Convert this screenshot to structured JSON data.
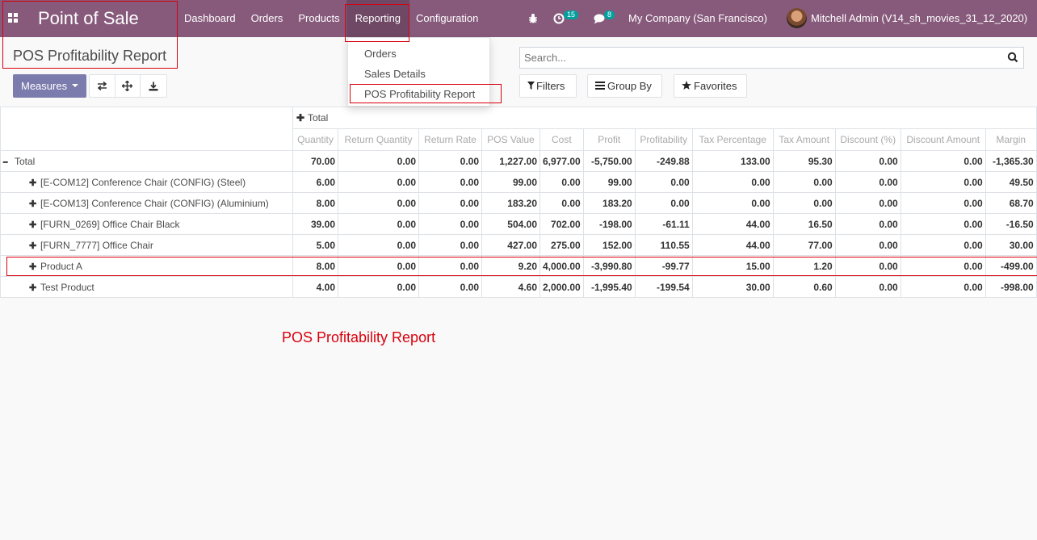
{
  "navbar": {
    "brand": "Point of Sale",
    "menu": [
      "Dashboard",
      "Orders",
      "Products",
      "Reporting",
      "Configuration"
    ],
    "activity_count": "15",
    "messages_count": "8",
    "company": "My Company (San Francisco)",
    "user": "Mitchell Admin (V14_sh_movies_31_12_2020)"
  },
  "reporting_menu": {
    "items": [
      "Orders",
      "Sales Details",
      "POS Profitability Report"
    ]
  },
  "control_panel": {
    "title": "POS Profitability Report",
    "measures_label": "Measures",
    "search_placeholder": "Search...",
    "filters_label": "Filters",
    "group_by_label": "Group By",
    "favorites_label": "Favorites"
  },
  "pivot": {
    "col_group_header": "Total",
    "measures": [
      "Quantity",
      "Return Quantity",
      "Return Rate",
      "POS Value",
      "Cost",
      "Profit",
      "Profitability",
      "Tax Percentage",
      "Tax Amount",
      "Discount (%)",
      "Discount Amount",
      "Margin"
    ],
    "rows": [
      {
        "label": "Total",
        "values": [
          "70.00",
          "0.00",
          "0.00",
          "1,227.00",
          "6,977.00",
          "-5,750.00",
          "-249.88",
          "133.00",
          "95.30",
          "0.00",
          "0.00",
          "-1,365.30"
        ]
      },
      {
        "label": "[E-COM12] Conference Chair (CONFIG) (Steel)",
        "values": [
          "6.00",
          "0.00",
          "0.00",
          "99.00",
          "0.00",
          "99.00",
          "0.00",
          "0.00",
          "0.00",
          "0.00",
          "0.00",
          "49.50"
        ]
      },
      {
        "label": "[E-COM13] Conference Chair (CONFIG) (Aluminium)",
        "values": [
          "8.00",
          "0.00",
          "0.00",
          "183.20",
          "0.00",
          "183.20",
          "0.00",
          "0.00",
          "0.00",
          "0.00",
          "0.00",
          "68.70"
        ]
      },
      {
        "label": "[FURN_0269] Office Chair Black",
        "values": [
          "39.00",
          "0.00",
          "0.00",
          "504.00",
          "702.00",
          "-198.00",
          "-61.11",
          "44.00",
          "16.50",
          "0.00",
          "0.00",
          "-16.50"
        ]
      },
      {
        "label": "[FURN_7777] Office Chair",
        "values": [
          "5.00",
          "0.00",
          "0.00",
          "427.00",
          "275.00",
          "152.00",
          "110.55",
          "44.00",
          "77.00",
          "0.00",
          "0.00",
          "30.00"
        ]
      },
      {
        "label": "Product A",
        "values": [
          "8.00",
          "0.00",
          "0.00",
          "9.20",
          "4,000.00",
          "-3,990.80",
          "-99.77",
          "15.00",
          "1.20",
          "0.00",
          "0.00",
          "-499.00"
        ]
      },
      {
        "label": "Test Product",
        "values": [
          "4.00",
          "0.00",
          "0.00",
          "4.60",
          "2,000.00",
          "-1,995.40",
          "-199.54",
          "30.00",
          "0.60",
          "0.00",
          "0.00",
          "-998.00"
        ]
      }
    ]
  },
  "annotation": {
    "caption": "POS Profitability Report",
    "color": "#d9000d"
  },
  "colors": {
    "navbar": "#875a7b",
    "primary_button": "#7c7bad",
    "badge": "#00a09d"
  }
}
